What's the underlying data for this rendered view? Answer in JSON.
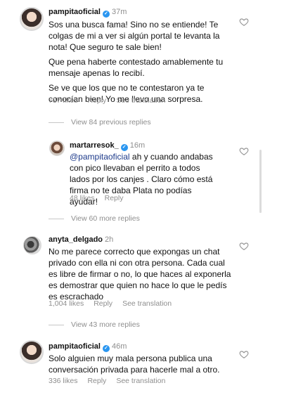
{
  "comments": [
    {
      "username": "pampitaoficial",
      "time": "37m",
      "paragraphs": [
        "Sos una busca fama! Sino no se entiende! Te colgas de mi a ver si algún portal te levanta la nota! Que seguro te sale bien!",
        "Que pena haberte contestado amablemente tu mensaje apenas lo recibí.",
        "Se ve que los que no te contestaron ya te conocían bien! Yo me llevo una sorpresa."
      ],
      "likes": "737 likes",
      "reply": "Reply",
      "translation": "See translation"
    },
    {
      "username": "martarresok_",
      "time": "16m",
      "mention": "@pampitaoficial",
      "text": " ah y cuando andabas con pico llevaban el perrito a todos lados por los canjes . Claro cómo está firma no te daba Plata no podías ayudar!",
      "likes": "48 likes",
      "reply": "Reply"
    },
    {
      "username": "anyta_delgado",
      "time": "2h",
      "text": "No me parece correcto que expongas un chat privado con ella ni con otra persona. Cada cual es libre de firmar o no, lo que haces al exponerla es demostrar que quien no hace lo que le pedís es escrachado",
      "likes": "1,004 likes",
      "reply": "Reply",
      "translation": "See translation"
    },
    {
      "username": "pampitaoficial",
      "time": "46m",
      "text": "Solo alguien muy mala persona publica una conversación privada para hacerle mal a otro.",
      "likes": "336 likes",
      "reply": "Reply",
      "translation": "See translation"
    }
  ],
  "view_replies": [
    "View 84 previous replies",
    "View 60 more replies",
    "View 43 more replies"
  ],
  "icons": {
    "verified": "verified-badge-icon",
    "like": "heart-outline-icon"
  },
  "colors": {
    "verified": "#2a96f0",
    "meta": "#8e8e8e",
    "mention": "#1d3a8a"
  }
}
